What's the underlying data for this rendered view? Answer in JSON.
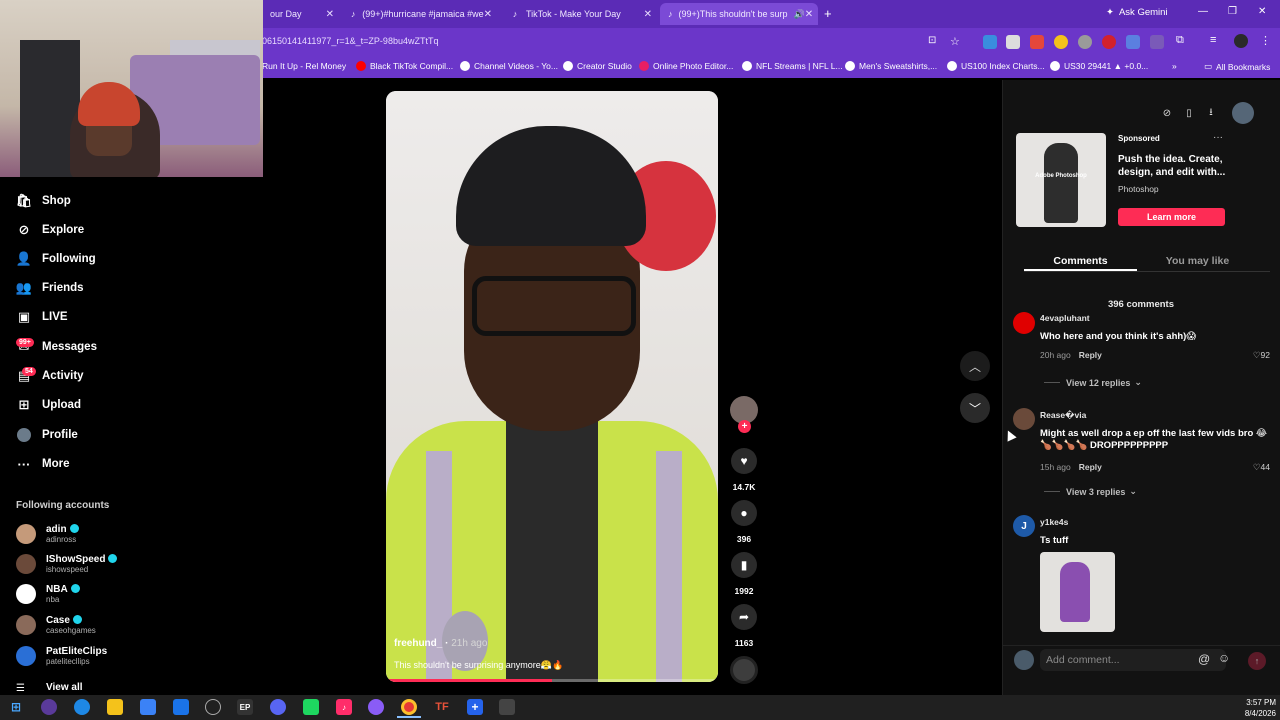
{
  "browser": {
    "tabs": [
      {
        "label": "our Day",
        "active": false
      },
      {
        "label": "(99+)#hurricane #jamaica #we",
        "active": false
      },
      {
        "label": "TikTok - Make Your Day",
        "active": false
      },
      {
        "label": "(99+)This shouldn't be surp",
        "active": true
      }
    ],
    "ask_gemini": "Ask Gemini",
    "url": "06150141411977_r=1&_t=ZP-98bu4wZTtTq",
    "bookmarks": [
      "Run It Up - Rel Money",
      "Black TikTok Compil...",
      "Channel Videos - Yo...",
      "Creator Studio",
      "Online Photo Editor...",
      "NFL Streams | NFL L...",
      "Men's Sweatshirts,...",
      "US100 Index Charts...",
      "US30 29441 ▲ +0.0..."
    ],
    "all_bookmarks": "All Bookmarks"
  },
  "sidebar": {
    "items": [
      {
        "label": "Shop",
        "icon": "shop-icon",
        "glyph": "🛍"
      },
      {
        "label": "Explore",
        "icon": "compass-icon",
        "glyph": "⊘"
      },
      {
        "label": "Following",
        "icon": "following-icon",
        "glyph": "👤"
      },
      {
        "label": "Friends",
        "icon": "friends-icon",
        "glyph": "👥"
      },
      {
        "label": "LIVE",
        "icon": "live-icon",
        "glyph": "▣"
      },
      {
        "label": "Messages",
        "icon": "messages-icon",
        "glyph": "✉",
        "badge": "99+"
      },
      {
        "label": "Activity",
        "icon": "activity-icon",
        "glyph": "▤",
        "badge": "54"
      },
      {
        "label": "Upload",
        "icon": "upload-icon",
        "glyph": "⊞"
      },
      {
        "label": "Profile",
        "icon": "profile-icon",
        "glyph": "●"
      },
      {
        "label": "More",
        "icon": "more-icon",
        "glyph": "···"
      }
    ],
    "following_heading": "Following accounts",
    "accounts": [
      {
        "name": "adin",
        "handle": "adinross",
        "verified": true,
        "color": "#c59a7a"
      },
      {
        "name": "IShowSpeed",
        "handle": "ishowspeed",
        "verified": true,
        "color": "#6b4a3a"
      },
      {
        "name": "NBA",
        "handle": "nba",
        "verified": true,
        "color": "#ffffff"
      },
      {
        "name": "Case",
        "handle": "caseohgames",
        "verified": true,
        "color": "#8a6a5a"
      },
      {
        "name": "PatEliteClips",
        "handle": "patelitecllips",
        "verified": false,
        "color": "#2a6fd6"
      }
    ],
    "view_all": "View all"
  },
  "video": {
    "creator": "freehund_",
    "ago": "21h ago",
    "caption": "This shouldn't be surprising anymore😤🔥",
    "progress": 0.5,
    "likes": "14.7K",
    "comments": "396",
    "saves": "1992",
    "shares": "1163"
  },
  "ad": {
    "sponsored": "Sponsored",
    "title": "Push the idea. Create, design, and edit with...",
    "brand": "Photoshop",
    "cta": "Learn more",
    "image_label": "Adobe Photoshop"
  },
  "panel": {
    "tabs": [
      "Comments",
      "You may like"
    ],
    "comment_count": "396 comments",
    "add_comment_placeholder": "Add comment..."
  },
  "comments": [
    {
      "user": "4evapluhant",
      "text": "Who here and you think it's ahh)😱",
      "ago": "20h ago",
      "reply": "Reply",
      "likes": "92",
      "replies": "View 12 replies",
      "avatar_color": "#e00000"
    },
    {
      "user": "Rease�via",
      "text": "Might as well drop a ep off the last few vids bro 😂🍗🍗🍗🍗 DROPPPPPPPPP",
      "ago": "15h ago",
      "reply": "Reply",
      "likes": "44",
      "replies": "View 3 replies",
      "avatar_color": "#6a4a3a"
    },
    {
      "user": "y1ke4s",
      "text": "Ts tuff",
      "avatar_color": "#1e5aa8",
      "avatar_letter": "J"
    }
  ],
  "taskbar": {
    "time": "3:57 PM",
    "date": "8/4/2026"
  }
}
